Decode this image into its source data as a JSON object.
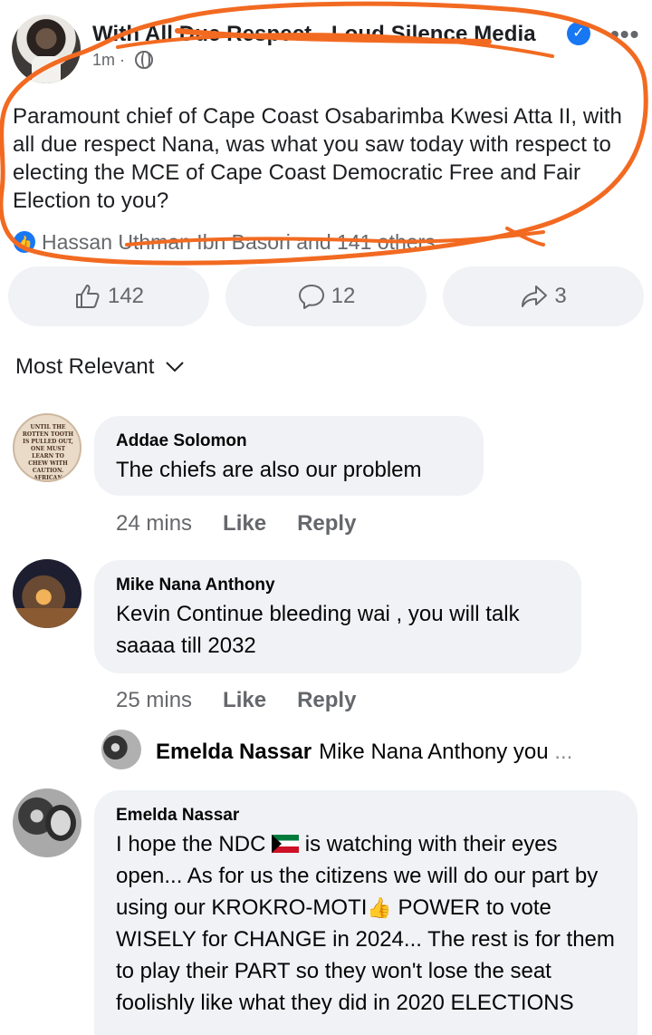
{
  "post": {
    "page_name": "With All Due Respect - Loud Silence Media",
    "meta": "1m ·",
    "text": "Paramount chief of Cape Coast Osabarimba Kwesi Atta II, with all due respect Nana, was what you saw today with respect to electing the MCE of Cape Coast Democratic Free and Fair Election to you?",
    "reactions_text": "Hassan Uthman Ibn Basori and 141 others"
  },
  "actions": {
    "like_count": "142",
    "comment_count": "12",
    "share_count": "3"
  },
  "sort": {
    "label": "Most Relevant"
  },
  "comments": [
    {
      "name": "Addae Solomon",
      "text": "The chiefs are also our problem",
      "time": "24 mins",
      "like": "Like",
      "reply": "Reply",
      "avatar_text": "Until the rotten tooth is pulled out, one must learn to chew with caution. African Proverb"
    },
    {
      "name": "Mike Nana Anthony",
      "text": "Kevin Continue bleeding wai , you will talk saaaa till 2032",
      "time": "25 mins",
      "like": "Like",
      "reply": "Reply"
    },
    {
      "name": "Emelda Nassar",
      "text_part1": "I hope the NDC ",
      "text_part2": " is watching with their eyes open... As for us the citizens we will do our part by using our KROKRO-MOTI",
      "text_part3": " POWER to vote WISELY for CHANGE in 2024... The rest is for them to play their PART so they won't lose the seat foolishly like what they did in 2020 ELECTIONS"
    }
  ],
  "reply_preview": {
    "name": "Emelda Nassar",
    "text": "Mike Nana Anthony you",
    "ellipsis": "..."
  },
  "colors": {
    "accent": "#1877f2",
    "scribble": "#f26a21",
    "bubble": "#f0f2f5",
    "muted": "#65676b"
  }
}
